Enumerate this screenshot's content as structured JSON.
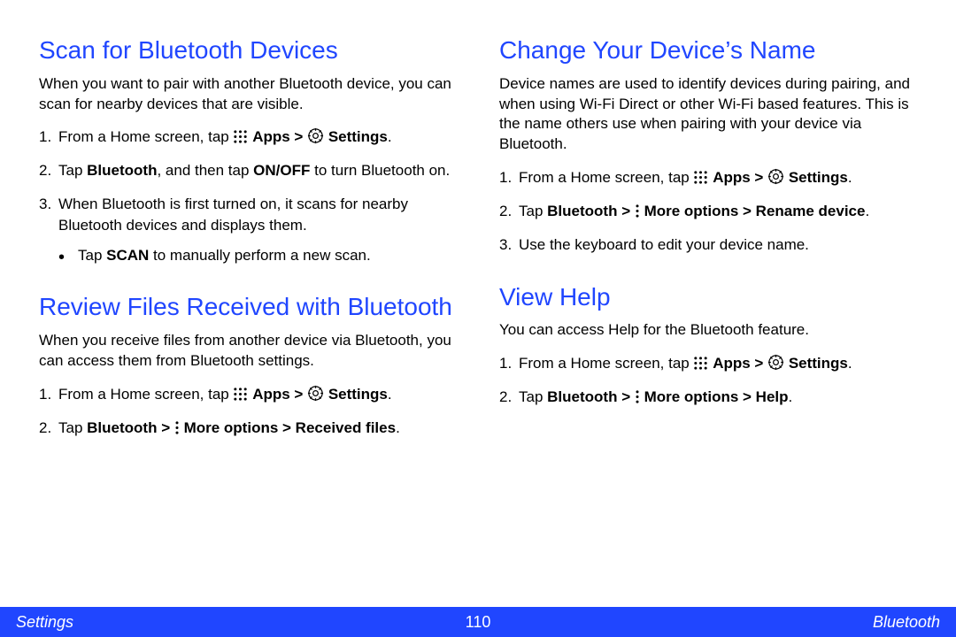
{
  "left": {
    "section1": {
      "heading": "Scan for Bluetooth Devices",
      "intro": "When you want to pair with another Bluetooth device, you can scan for nearby devices that are visible.",
      "step1_a": "From a Home screen, tap ",
      "step1_apps": "Apps",
      "step1_gt": " > ",
      "step1_settings": "Settings",
      "step1_d": ".",
      "step2_a": "Tap ",
      "step2_b": "Bluetooth",
      "step2_c": ", and then tap ",
      "step2_d": "ON/OFF",
      "step2_e": " to turn Bluetooth on.",
      "step3": "When Bluetooth is first turned on, it scans for nearby Bluetooth devices and displays them.",
      "bullet_a": "Tap ",
      "bullet_b": "SCAN",
      "bullet_c": " to manually perform a new scan."
    },
    "section2": {
      "heading": "Review Files Received with Bluetooth",
      "intro": "When you receive files from another device via Bluetooth, you can access them from Bluetooth settings.",
      "step1_a": "From a Home screen, tap ",
      "step1_apps": "Apps",
      "step1_gt": " > ",
      "step1_settings": "Settings",
      "step1_d": ".",
      "step2_a": "Tap ",
      "step2_b": "Bluetooth",
      "step2_gt1": " > ",
      "step2_more": "More options",
      "step2_gt2": " > ",
      "step2_recv": "Received files",
      "step2_d": "."
    }
  },
  "right": {
    "section1": {
      "heading": "Change Your Device’s Name",
      "intro": "Device names are used to identify devices during pairing, and when using Wi-Fi Direct or other Wi-Fi based features. This is the name others use when pairing with your device via Bluetooth.",
      "step1_a": "From a Home screen, tap ",
      "step1_apps": "Apps",
      "step1_gt": " > ",
      "step1_settings": "Settings",
      "step1_d": ".",
      "step2_a": "Tap ",
      "step2_b": "Bluetooth",
      "step2_gt1": " > ",
      "step2_more": "More options",
      "step2_gt2": " > ",
      "step2_ren1": "Rename device",
      "step2_d": ".",
      "step3": "Use the keyboard to edit your device name."
    },
    "section2": {
      "heading": "View Help",
      "intro": "You can access Help for the Bluetooth feature.",
      "step1_a": "From a Home screen, tap ",
      "step1_apps": "Apps",
      "step1_gt": " > ",
      "step1_settings": "Settings",
      "step1_d": ".",
      "step2_a": "Tap ",
      "step2_b": "Bluetooth",
      "step2_gt1": " > ",
      "step2_more": "More options",
      "step2_gt2": " > ",
      "step2_help": "Help",
      "step2_d": "."
    }
  },
  "footer": {
    "left": "Settings",
    "center": "110",
    "right": "Bluetooth"
  }
}
